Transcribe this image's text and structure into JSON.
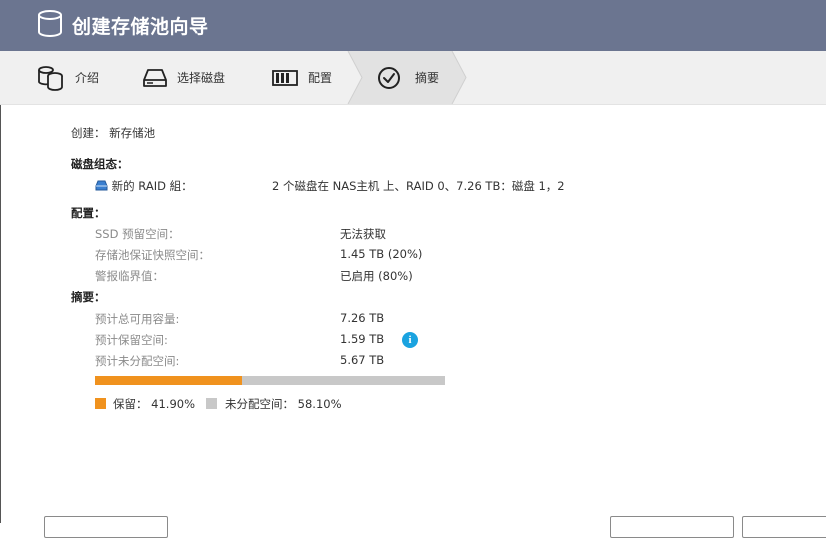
{
  "window": {
    "title": "创建存储池向导"
  },
  "steps": [
    {
      "label": "介绍",
      "icon": "database-icon",
      "active": false
    },
    {
      "label": "选择磁盘",
      "icon": "disk-drive-icon",
      "active": false
    },
    {
      "label": "配置",
      "icon": "raid-config-icon",
      "active": false
    },
    {
      "label": "摘要",
      "icon": "checkmark-circle-icon",
      "active": true
    }
  ],
  "summary": {
    "create_label": "创建：",
    "create_value": "新存储池",
    "disk_group_header": "磁盘组态：",
    "raid_group_label": "新的 RAID 組：",
    "raid_group_value": "2 个磁盘在 NAS主机 上、RAID 0、7.26 TB：磁盘 1，2",
    "config_header": "配置：",
    "config_rows": [
      {
        "label": "SSD 预留空间：",
        "value": "无法获取"
      },
      {
        "label": "存储池保证快照空间：",
        "value": "1.45 TB (20%)"
      },
      {
        "label": "警报临界值：",
        "value": "已启用 (80%)"
      }
    ],
    "abstract_header": "摘要：",
    "abstract_rows": [
      {
        "label": "预计总可用容量:",
        "value": "7.26 TB"
      },
      {
        "label": "预计保留空间:",
        "value": "1.59 TB"
      },
      {
        "label": "预计未分配空间:",
        "value": "5.67 TB"
      }
    ],
    "usage": {
      "reserved_fraction": 0.419,
      "reserved_color": "#f0921e",
      "unallocated_color": "#c8c8c8"
    },
    "legend": {
      "reserved_label": "保留：",
      "reserved_pct": "41.90%",
      "unallocated_label": "未分配空间：",
      "unallocated_pct": "58.10%"
    }
  },
  "colors": {
    "titlebar": "#6b7590",
    "info": "#1aa3e0"
  }
}
